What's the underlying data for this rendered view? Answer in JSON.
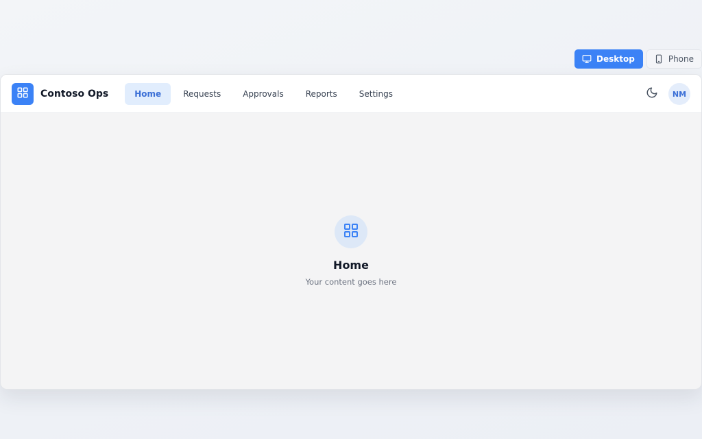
{
  "view_toggle": {
    "desktop": {
      "label": "Desktop",
      "icon": "monitor-icon",
      "active": true
    },
    "phone": {
      "label": "Phone",
      "icon": "smartphone-icon",
      "active": false
    }
  },
  "header": {
    "app_name": "Contoso Ops",
    "logo_icon": "grid-icon",
    "nav": [
      {
        "label": "Home",
        "active": true
      },
      {
        "label": "Requests",
        "active": false
      },
      {
        "label": "Approvals",
        "active": false
      },
      {
        "label": "Reports",
        "active": false
      },
      {
        "label": "Settings",
        "active": false
      }
    ],
    "theme_icon": "moon-icon",
    "avatar_initials": "NM"
  },
  "main": {
    "icon": "grid-icon",
    "title": "Home",
    "subtitle": "Your content goes here"
  },
  "colors": {
    "accent": "#3b82f6",
    "accent_soft": "#e1edfd",
    "text_primary": "#111827",
    "text_muted": "#6b7280",
    "content_bg": "#f4f4f5"
  }
}
